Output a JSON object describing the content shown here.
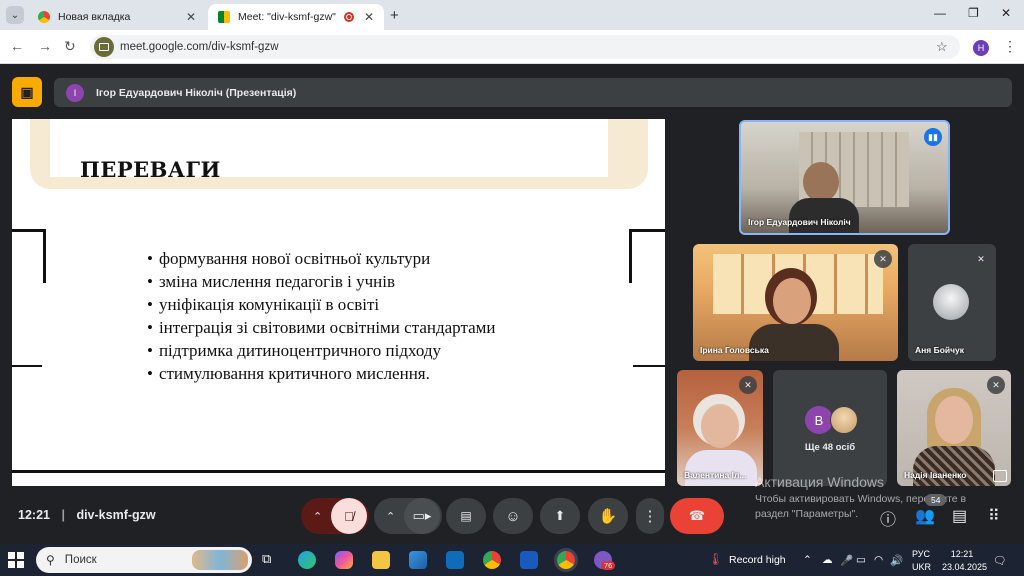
{
  "browser": {
    "tabs": [
      {
        "title": "Новая вкладка",
        "icon": "chrome-icon"
      },
      {
        "title": "Meet: \"div-ksmf-gzw\"",
        "icon": "meet-icon",
        "recording": true
      }
    ],
    "url": "meet.google.com/div-ksmf-gzw",
    "profile_initial": "H"
  },
  "meet": {
    "presenter_initial": "І",
    "presenter_label": "Ігор Едуардович Ніколіч (Презентація)",
    "slide": {
      "title": "ПЕРЕВАГИ",
      "bullets": [
        "формування нової освітньої культури",
        "зміна мислення педагогів і учнів",
        "уніфікація комунікації в освіті",
        "інтеграція зі світовими освітніми стандартами",
        "підтримка дитиноцентричного підходу",
        "стимулювання критичного мислення."
      ]
    },
    "participants": [
      {
        "name": "Ігор Едуардович Ніколіч",
        "speaking": true
      },
      {
        "name": "Ірина Головська",
        "muted": true
      },
      {
        "name": "Аня Бойчук",
        "muted": true
      },
      {
        "name": "Валентина Іл...",
        "muted": true
      },
      {
        "name": "Надія Іваненко",
        "muted": true
      }
    ],
    "others_avatar": "В",
    "others_label": "Ще 48 осіб",
    "participants_count": "54",
    "time": "12:21",
    "meeting_code": "div-ksmf-gzw"
  },
  "watermark": {
    "line1": "Активация Windows",
    "line2": "Чтобы активировать Windows, перейдите в раздел \"Параметры\"."
  },
  "taskbar": {
    "search_placeholder": "Поиск",
    "badge": "76",
    "tray_record": "Record high",
    "lang_top": "РУС",
    "lang_bottom": "UKR",
    "clock_time": "12:21",
    "clock_date": "23.04.2025"
  },
  "colors": {
    "accent": "#f9ab00",
    "end_call": "#ea4335",
    "meet_bg": "#202124"
  }
}
